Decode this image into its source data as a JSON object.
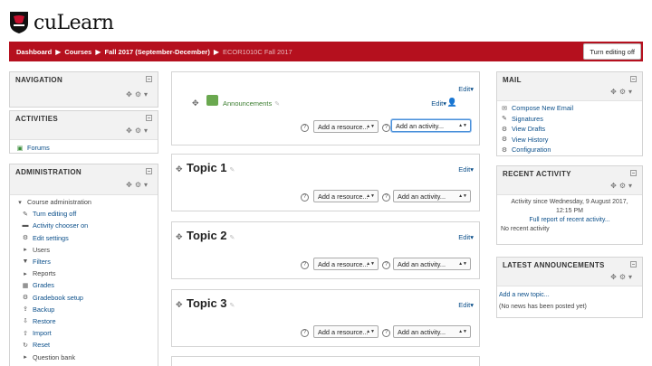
{
  "brand": {
    "name": "cuLearn",
    "accent": "#b5101e"
  },
  "breadcrumb": {
    "items": [
      "Dashboard",
      "Courses",
      "Fall 2017 (September-December)",
      "ECOR1010C Fall 2017"
    ]
  },
  "header": {
    "edit_button": "Turn editing off"
  },
  "navigation": {
    "title": "NAVIGATION"
  },
  "activities": {
    "title": "ACTIVITIES",
    "items": [
      "Forums"
    ]
  },
  "administration": {
    "title": "ADMINISTRATION",
    "items": [
      {
        "label": "Course administration",
        "icon": "caret-down-icon"
      },
      {
        "label": "Turn editing off",
        "icon": "pencil-icon"
      },
      {
        "label": "Activity chooser on",
        "icon": "dash-icon"
      },
      {
        "label": "Edit settings",
        "icon": "gear-icon"
      },
      {
        "label": "Users",
        "icon": "caret-right-icon"
      },
      {
        "label": "Filters",
        "icon": "filter-icon"
      },
      {
        "label": "Reports",
        "icon": "caret-right-icon"
      },
      {
        "label": "Grades",
        "icon": "grades-icon"
      },
      {
        "label": "Gradebook setup",
        "icon": "gear-icon"
      },
      {
        "label": "Backup",
        "icon": "backup-icon"
      },
      {
        "label": "Restore",
        "icon": "restore-icon"
      },
      {
        "label": "Import",
        "icon": "import-icon"
      },
      {
        "label": "Reset",
        "icon": "reset-icon"
      },
      {
        "label": "Question bank",
        "icon": "caret-right-icon"
      }
    ]
  },
  "sections": {
    "edit_label": "Edit",
    "add_resource": "Add a resource...",
    "add_activity": "Add an activity...",
    "intro": {
      "announcements": "Announcements"
    },
    "topics": [
      "Topic 1",
      "Topic 2",
      "Topic 3"
    ]
  },
  "mail": {
    "title": "MAIL",
    "items": [
      {
        "label": "Compose New Email",
        "icon": "mail-icon"
      },
      {
        "label": "Signatures",
        "icon": "pencil-icon"
      },
      {
        "label": "View Drafts",
        "icon": "gear-icon"
      },
      {
        "label": "View History",
        "icon": "gear-icon"
      },
      {
        "label": "Configuration",
        "icon": "gear-icon"
      }
    ]
  },
  "recent_activity": {
    "title": "RECENT ACTIVITY",
    "since_line1": "Activity since Wednesday, 9 August 2017,",
    "since_line2": "12:15 PM",
    "full_report": "Full report of recent activity...",
    "none": "No recent activity"
  },
  "latest_announcements": {
    "title": "LATEST ANNOUNCEMENTS",
    "add_topic": "Add a new topic...",
    "none": "(No news has been posted yet)"
  }
}
